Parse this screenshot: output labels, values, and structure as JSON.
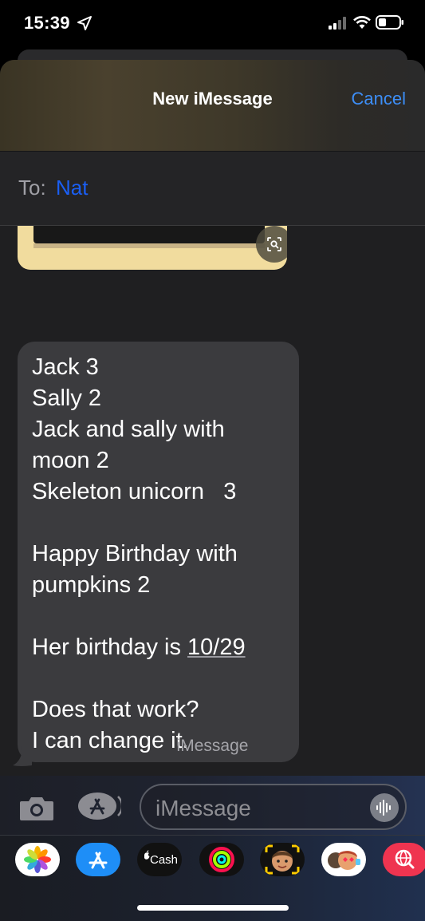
{
  "status_bar": {
    "time": "15:39"
  },
  "nav": {
    "title": "New iMessage",
    "cancel_label": "Cancel"
  },
  "recipient": {
    "label": "To:",
    "name": "Nat"
  },
  "message": {
    "lines": [
      "Jack 3",
      "Sally 2",
      "Jack and sally with",
      "moon 2",
      "Skeleton unicorn   3",
      "",
      "Happy Birthday with",
      "pumpkins 2",
      "",
      "Her birthday is ",
      "",
      "Does that work?",
      "I can change it."
    ],
    "date_link": "10/29"
  },
  "service_label": "iMessage",
  "composer": {
    "placeholder": "iMessage"
  },
  "app_drawer": {
    "apps": [
      "photos-app-icon",
      "app-store-icon",
      "apple-cash-icon",
      "activity-icon",
      "memoji-icon",
      "memoji-stickers-icon",
      "web-search-icon"
    ],
    "cash_label": "Cash"
  },
  "colors": {
    "accent": "#3d8ef7",
    "recipient": "#1a5ff5",
    "bubble": "#3b3b3e",
    "background": "#1f1f21"
  }
}
